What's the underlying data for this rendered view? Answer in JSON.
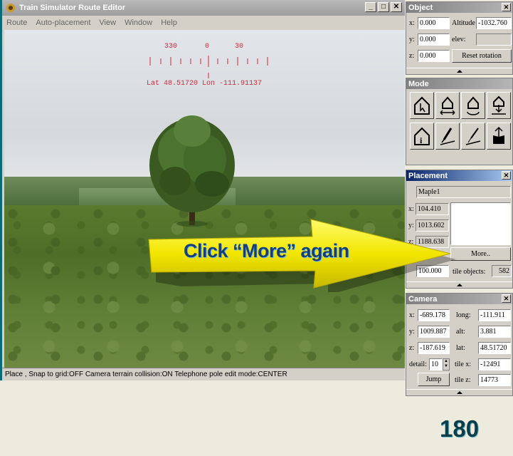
{
  "window": {
    "title": "Train Simulator Route Editor",
    "minimize": "_",
    "maximize": "□",
    "close": "✕"
  },
  "menu": [
    "Route",
    "Auto-placement",
    "View",
    "Window",
    "Help"
  ],
  "viewport": {
    "compass_ticks": [
      "330",
      "0",
      "30"
    ],
    "coords": "Lat 48.51720 Lon -111.91137"
  },
  "status_bar": "Place , Snap to grid:OFF Camera terrain collision:ON Telephone pole edit mode:CENTER",
  "annotation": {
    "arrow_text": "Click “More” again",
    "page_number": "180"
  },
  "object_panel": {
    "title": "Object",
    "x_label": "x:",
    "x": "0.000",
    "y_label": "y:",
    "y": "0.000",
    "z_label": "z:",
    "z": "0.000",
    "altitude_label": "Altitude",
    "altitude": "-1032.760",
    "elev_label": "elev:",
    "elev": "",
    "reset_rotation": "Reset rotation"
  },
  "mode_panel": {
    "title": "Mode",
    "buttons": [
      "select-icon",
      "move-icon",
      "rotate-icon",
      "drop-icon",
      "info-icon",
      "terrain-paint-icon",
      "terrain-smooth-icon",
      "raise-icon"
    ]
  },
  "placement_panel": {
    "title": "Placement",
    "object_name": "Maple1",
    "x_label": "x:",
    "x": "104.410",
    "y_label": "y:",
    "y": "1013.602",
    "z_label": "z:",
    "z": "1188.638",
    "more_button": "More..",
    "scale": "100.000",
    "tile_objects_label": "tile objects:",
    "tile_objects": "582"
  },
  "camera_panel": {
    "title": "Camera",
    "x_label": "x:",
    "x": "-689.178",
    "y_label": "y:",
    "y": "1009.887",
    "z_label": "z:",
    "z": "-187.619",
    "long_label": "long:",
    "long": "-111.911",
    "alt_label": "alt:",
    "alt": "3.881",
    "lat_label": "lat:",
    "lat": "48.51720",
    "detail_label": "detail:",
    "detail": "10",
    "tile_x_label": "tile x:",
    "tile_x": "-12491",
    "tile_z_label": "tile z:",
    "tile_z": "14773",
    "jump_button": "Jump"
  }
}
